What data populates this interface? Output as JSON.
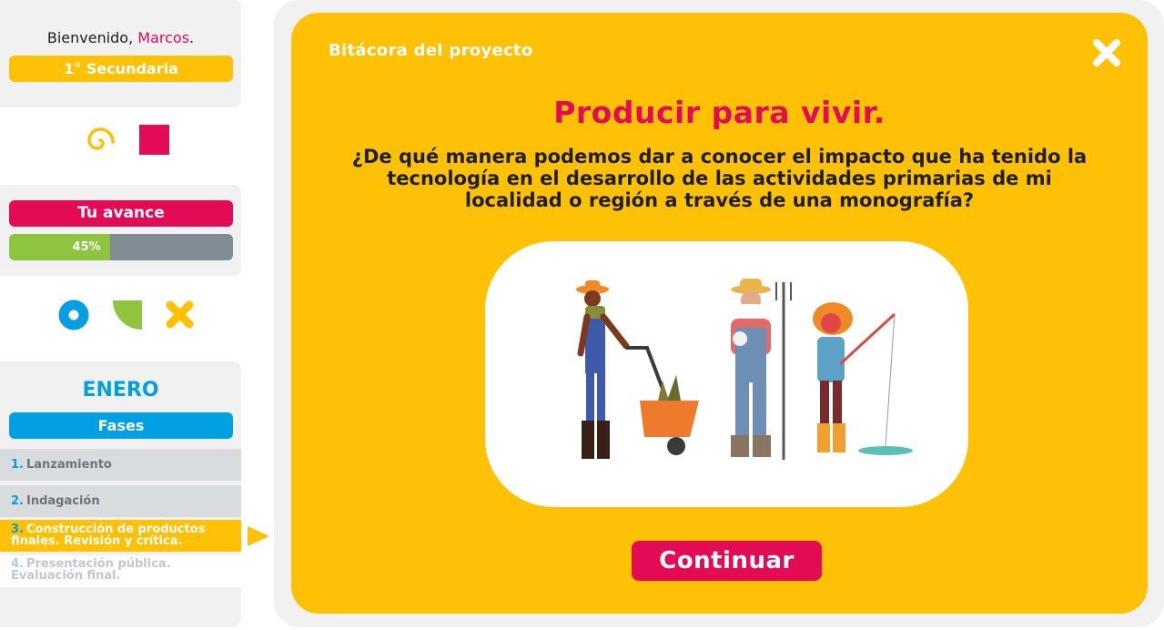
{
  "sidebar": {
    "welcome_prefix": "Bienvenido,",
    "user_name": "Marcos",
    "welcome_suffix": ".",
    "grade": "1° Secundaria",
    "progress_label": "Tu avance",
    "progress_value": 0.45,
    "progress_text": "45%",
    "month": "ENERO",
    "phases_label": "Fases",
    "phases": [
      {
        "num": "1.",
        "label": "Lanzamiento",
        "state": "done"
      },
      {
        "num": "2.",
        "label": "Indagación",
        "state": "done"
      },
      {
        "num": "3.",
        "label": "Construcción de productos finales. Revisión y crítica.",
        "state": "current"
      },
      {
        "num": "4.",
        "label": "Presentación pública. Evaluación final.",
        "state": "pending"
      }
    ]
  },
  "main": {
    "title": "Bitácora del proyecto",
    "heading": "Producir para vivir.",
    "question": "¿De qué manera podemos dar a conocer el impacto que ha tenido la tecnología en el desarrollo de las actividades primarias de mi localidad o región a través de una  monografía?",
    "continue_label": "Continuar"
  },
  "icons": {
    "close": "close-icon",
    "spiral": "spiral-icon",
    "square": "square-shape-icon",
    "circle": "ring-icon",
    "leaf": "quarter-circle-icon",
    "cross": "cross-icon",
    "arrow": "play-arrow-icon"
  },
  "colors": {
    "primary_yellow": "#fec106",
    "accent_pink": "#e30b55",
    "accent_blue": "#00a0e3",
    "accent_green": "#8fc43f",
    "panel_gray": "#f1f1f2"
  }
}
